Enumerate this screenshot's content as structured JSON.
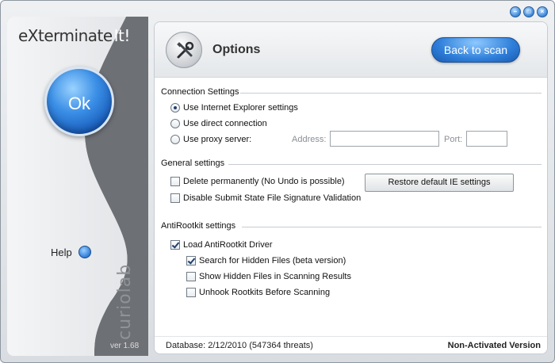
{
  "window": {
    "controls": [
      "minimize-icon",
      "maximize-icon",
      "close-icon"
    ]
  },
  "sidebar": {
    "logo_text": "eXterminate",
    "logo_suffix": "It!",
    "ok_label": "Ok",
    "help_label": "Help",
    "brand": "curiolab",
    "version": "ver 1.68"
  },
  "header": {
    "title": "Options",
    "back_label": "Back to scan"
  },
  "connection": {
    "section_title": "Connection Settings",
    "options": [
      {
        "label": "Use Internet Explorer settings",
        "selected": true
      },
      {
        "label": "Use direct connection",
        "selected": false
      },
      {
        "label": "Use proxy server:",
        "selected": false
      }
    ],
    "address_label": "Address:",
    "address_value": "",
    "port_label": "Port:",
    "port_value": ""
  },
  "general": {
    "section_title": "General settings",
    "delete_permanently": {
      "label": "Delete permanently (No Undo is possible)",
      "checked": false
    },
    "disable_signature": {
      "label": "Disable Submit State File Signature Validation",
      "checked": false
    },
    "restore_label": "Restore default IE settings"
  },
  "antirootkit": {
    "section_title": "AntiRootkit settings",
    "load_driver": {
      "label": "Load AntiRootkit Driver",
      "checked": true
    },
    "search_hidden": {
      "label": "Search for Hidden Files (beta version)",
      "checked": true
    },
    "show_hidden": {
      "label": "Show Hidden Files in Scanning Results",
      "checked": false
    },
    "unhook": {
      "label": "Unhook Rootkits Before Scanning",
      "checked": false
    }
  },
  "status": {
    "database": "Database: 2/12/2010 (547364 threats)",
    "activation": "Non-Activated Version"
  },
  "colors": {
    "accent": "#2f7fda",
    "sidebar": "#6d7075"
  }
}
